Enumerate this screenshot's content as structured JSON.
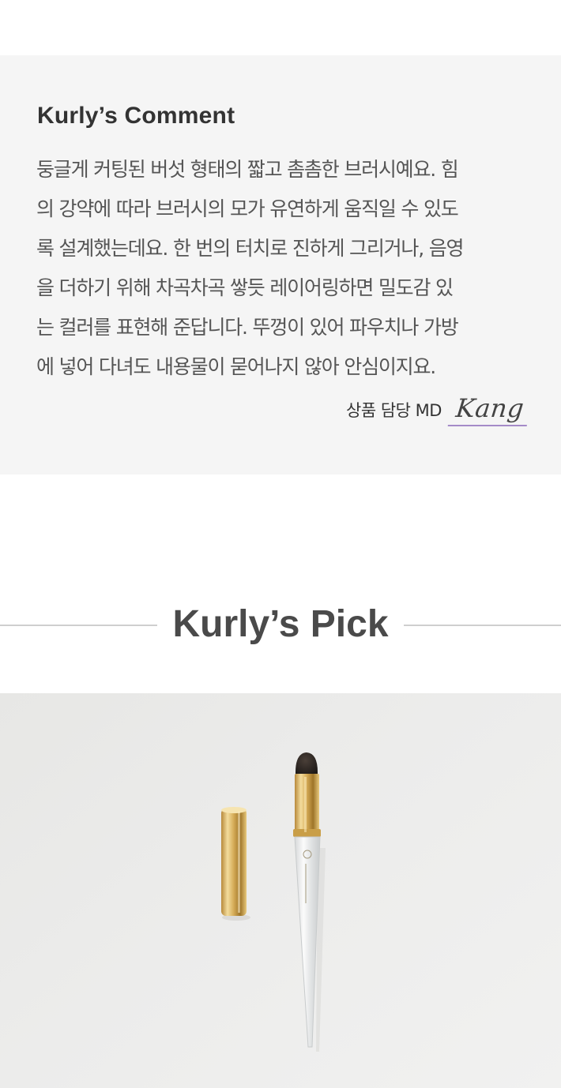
{
  "comment": {
    "title": "Kurly’s Comment",
    "lines": [
      "둥글게 커팅된 버섯 형태의 짧고 촘촘한 브러시예요. 힘",
      "의 강약에 따라 브러시의 모가 유연하게 움직일 수 있도",
      "록 설계했는데요. 한 번의 터치로 진하게 그리거나, 음영",
      "을 더하기 위해 차곡차곡 쌓듯 레이어링하면 밀도감 있",
      "는 컬러를 표현해 준답니다. 뚜껑이 있어 파우치나 가방",
      "에 넣어 다녀도 내용물이 묻어나지 않아 안심이지요."
    ],
    "md_label": "상품 담당 MD",
    "md_name": "Kang"
  },
  "pick": {
    "title": "Kurly’s Pick"
  },
  "product_image": {
    "alt": "gold-and-clear-makeup-brush-with-cap",
    "background": "#ebebea",
    "gold": "#d7b15f",
    "bristle": "#2a2522"
  }
}
